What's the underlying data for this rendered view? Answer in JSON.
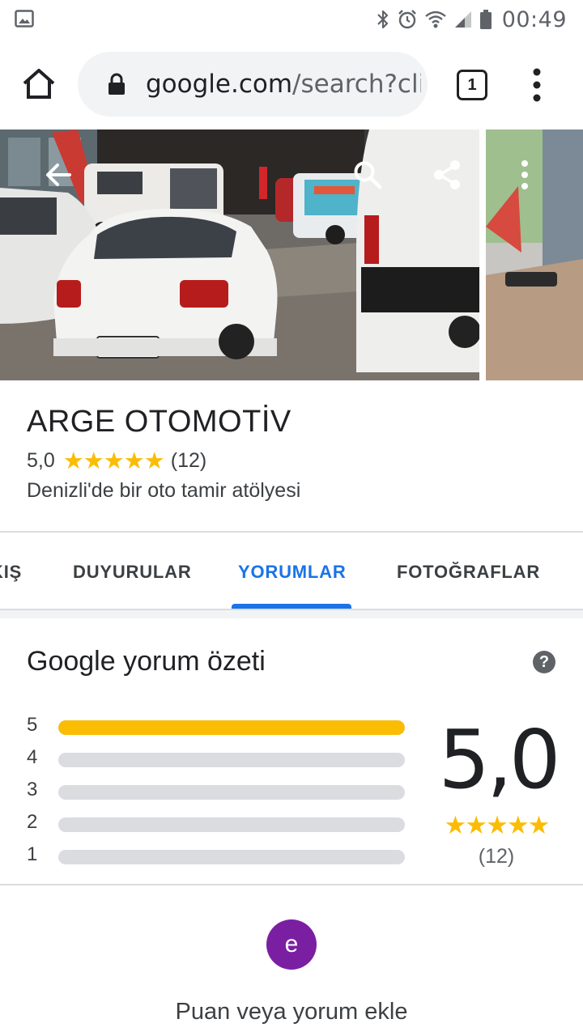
{
  "status_bar": {
    "time": "00:49",
    "icons": [
      "image-notification-icon",
      "bluetooth-icon",
      "alarm-icon",
      "wifi-icon",
      "signal-icon",
      "battery-icon"
    ]
  },
  "browser": {
    "url_domain": "google.com",
    "url_path": "/search?cli",
    "tab_count": "1"
  },
  "place": {
    "name": "ARGE OTOMOTİV",
    "rating": "5,0",
    "stars": "★★★★★",
    "review_count": "(12)",
    "category": "Denizli'de bir oto tamir atölyesi"
  },
  "tabs": [
    {
      "label": "KIŞ",
      "active": false
    },
    {
      "label": "DUYURULAR",
      "active": false
    },
    {
      "label": "YORUMLAR",
      "active": true
    },
    {
      "label": "FOTOĞRAFLAR",
      "active": false
    }
  ],
  "review_summary": {
    "title": "Google yorum özeti",
    "help": "?",
    "bars": [
      {
        "label": "5",
        "fraction": 1.0
      },
      {
        "label": "4",
        "fraction": 0.0
      },
      {
        "label": "3",
        "fraction": 0.0
      },
      {
        "label": "2",
        "fraction": 0.0
      },
      {
        "label": "1",
        "fraction": 0.0
      }
    ],
    "score": "5,0",
    "stars": "★★★★★",
    "count": "(12)"
  },
  "add_review": {
    "avatar_letter": "e",
    "label": "Puan veya yorum ekle"
  },
  "colors": {
    "accent": "#1a73e8",
    "star": "#fbbc04",
    "avatar": "#7b1fa2"
  }
}
